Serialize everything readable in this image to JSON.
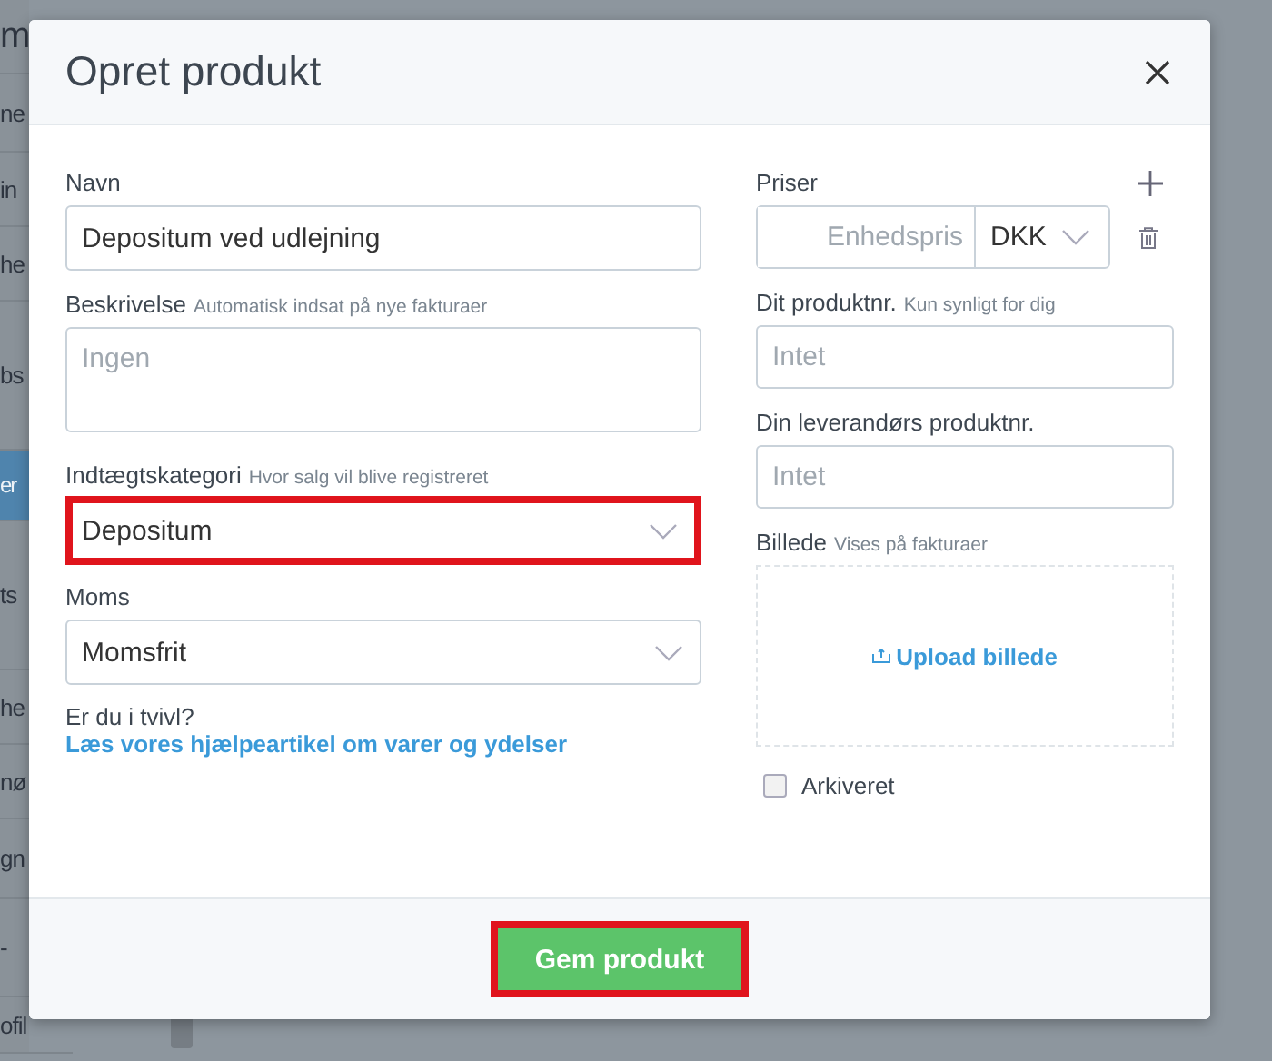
{
  "background": {
    "sidebar_items": [
      {
        "label": "m",
        "selected": false
      },
      {
        "label": "ne",
        "selected": false
      },
      {
        "label": "in",
        "selected": false
      },
      {
        "label": "he",
        "selected": false
      },
      {
        "label": "bs",
        "selected": false
      },
      {
        "label": "er",
        "selected": true
      },
      {
        "label": "ts",
        "selected": false
      },
      {
        "label": "he",
        "selected": false
      },
      {
        "label": "nø",
        "selected": false
      },
      {
        "label": "gn",
        "selected": false
      },
      {
        "label": "-",
        "selected": false
      },
      {
        "label": "ofil",
        "selected": false
      }
    ]
  },
  "dialog": {
    "title": "Opret produkt",
    "left": [
      {
        "kind": "input",
        "label": "Navn",
        "value": "Depositum ved udlejning"
      },
      {
        "kind": "textarea",
        "label": "Beskrivelse",
        "hint": "Automatisk indsat på nye fakturaer",
        "placeholder": "Ingen"
      },
      {
        "kind": "select",
        "label": "Indtægtskategori",
        "hint": "Hvor salg vil blive registreret",
        "value": "Depositum",
        "highlighted": true
      },
      {
        "kind": "select",
        "label": "Moms",
        "value": "Momsfrit",
        "highlighted": false
      }
    ],
    "help": {
      "text": "Er du i tvivl?",
      "link": "Læs vores hjælpeartikel om varer og ydelser"
    },
    "prices": {
      "label": "Priser",
      "placeholder": "Enhedspris",
      "currency": "DKK"
    },
    "right": [
      {
        "label": "Dit produktnr.",
        "hint": "Kun synligt for dig",
        "placeholder": "Intet"
      },
      {
        "label": "Din leverandørs produktnr.",
        "placeholder": "Intet"
      }
    ],
    "image": {
      "label": "Billede",
      "hint": "Vises på fakturaer",
      "upload": "Upload billede"
    },
    "archived": {
      "label": "Arkiveret",
      "checked": false
    },
    "save_button": {
      "label": "Gem produkt",
      "highlighted": true
    }
  }
}
